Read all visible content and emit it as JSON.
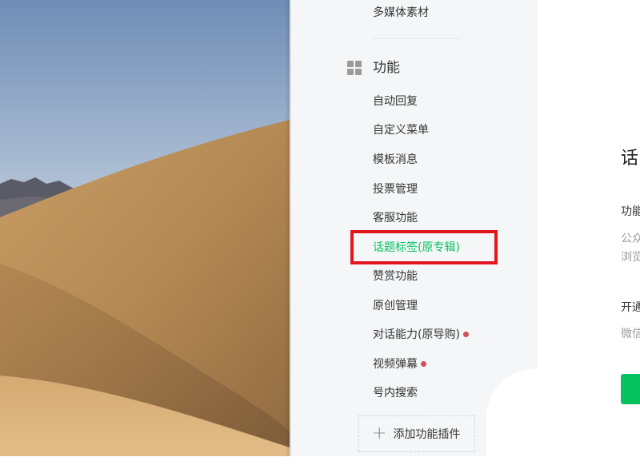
{
  "sidebar": {
    "top_item": "多媒体素材",
    "group_title": "功能",
    "items": [
      {
        "label": "自动回复"
      },
      {
        "label": "自定义菜单"
      },
      {
        "label": "模板消息"
      },
      {
        "label": "投票管理"
      },
      {
        "label": "客服功能"
      },
      {
        "label": "话题标签(原专辑)"
      },
      {
        "label": "赞赏功能"
      },
      {
        "label": "原创管理"
      },
      {
        "label": "对话能力(原导购)"
      },
      {
        "label": "视频弹幕"
      },
      {
        "label": "号内搜索"
      }
    ],
    "add_plugin_label": "添加功能插件"
  },
  "main": {
    "title": "话",
    "section1_label": "功能",
    "section1_line1": "公众",
    "section1_line2": "浏览",
    "section2_label": "开通",
    "section2_line1": "微信"
  },
  "colors": {
    "accent": "#07c160",
    "highlight": "#e3161f",
    "badge": "#d1505a"
  }
}
